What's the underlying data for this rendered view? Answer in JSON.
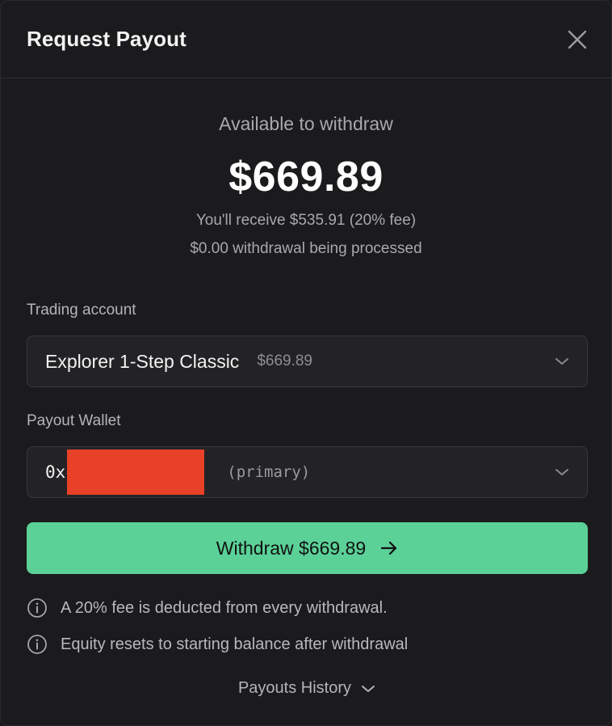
{
  "header": {
    "title": "Request Payout",
    "close_icon": "close-icon"
  },
  "summary": {
    "label": "Available to withdraw",
    "amount": "$669.89",
    "receive_text": "You'll receive $535.91 (20% fee)",
    "processing_text": "$0.00 withdrawal being processed"
  },
  "trading_account": {
    "label": "Trading account",
    "selected_name": "Explorer 1-Step Classic",
    "selected_balance": "$669.89",
    "icon": "chevron-down-icon"
  },
  "payout_wallet": {
    "label": "Payout Wallet",
    "address_prefix": "0x",
    "tag": "(primary)",
    "redaction_color": "#e84128",
    "icon": "chevron-down-icon"
  },
  "withdraw_button": {
    "label": "Withdraw $669.89",
    "color": "#5bd197",
    "icon": "arrow-right-icon"
  },
  "notes": [
    {
      "icon": "info-icon",
      "text": "A 20% fee is deducted from every withdrawal."
    },
    {
      "icon": "info-icon",
      "text": "Equity resets to starting balance after withdrawal"
    }
  ],
  "history": {
    "label": "Payouts History",
    "icon": "chevron-down-icon"
  }
}
